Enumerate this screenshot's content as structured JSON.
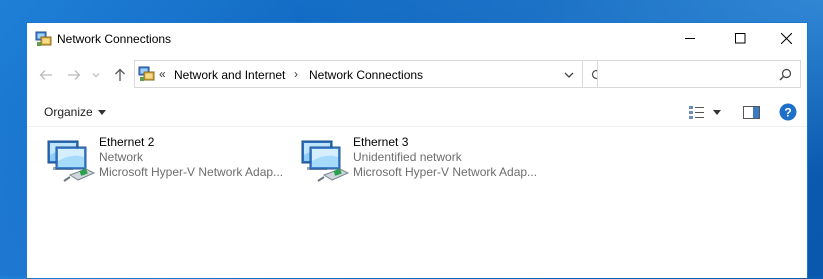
{
  "window": {
    "title": "Network Connections"
  },
  "address_bar": {
    "overflow_chevron": "«",
    "crumbs": [
      "Network and Internet",
      "Network Connections"
    ],
    "separator": "›"
  },
  "search": {
    "placeholder": ""
  },
  "command_bar": {
    "organize_label": "Organize"
  },
  "connections": [
    {
      "name": "Ethernet 2",
      "status": "Network",
      "adapter": "Microsoft Hyper-V Network Adap..."
    },
    {
      "name": "Ethernet 3",
      "status": "Unidentified network",
      "adapter": "Microsoft Hyper-V Network Adap..."
    }
  ],
  "colors": {
    "desktop": "#0b5fb8",
    "window_border": "#1a78d0",
    "help_icon": "#1e6fc9",
    "secondary_text": "#6d6d6d"
  }
}
